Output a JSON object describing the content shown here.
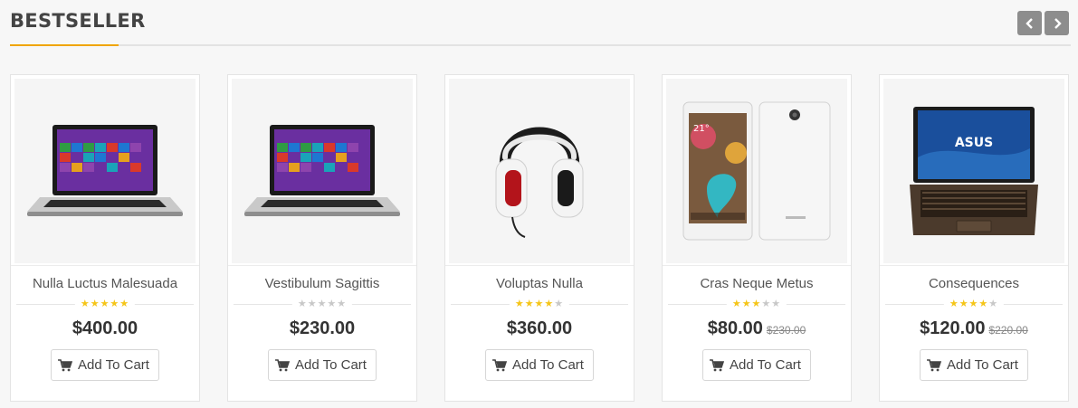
{
  "section": {
    "title": "BESTSELLER"
  },
  "colors": {
    "accent": "#f0a500",
    "star_on": "#f5c518",
    "star_off": "#c8c8c8",
    "nav": "#8d8d8d"
  },
  "nav": {
    "prev_icon": "chevron-left-icon",
    "next_icon": "chevron-right-icon"
  },
  "products": [
    {
      "name": "Nulla Luctus Malesuada",
      "rating": 5,
      "price": "$400.00",
      "old_price": "",
      "button": "Add To Cart",
      "image": "laptop-windows"
    },
    {
      "name": "Vestibulum Sagittis",
      "rating": 0,
      "price": "$230.00",
      "old_price": "",
      "button": "Add To Cart",
      "image": "laptop-windows"
    },
    {
      "name": "Voluptas Nulla",
      "rating": 4,
      "price": "$360.00",
      "old_price": "",
      "button": "Add To Cart",
      "image": "headphones"
    },
    {
      "name": "Cras Neque Metus",
      "rating": 3,
      "price": "$80.00",
      "old_price": "$230.00",
      "button": "Add To Cart",
      "image": "smartphone",
      "image_text": "21°"
    },
    {
      "name": "Consequences",
      "rating": 4,
      "price": "$120.00",
      "old_price": "$220.00",
      "button": "Add To Cart",
      "image": "laptop-asus",
      "image_text": "ASUS"
    }
  ]
}
